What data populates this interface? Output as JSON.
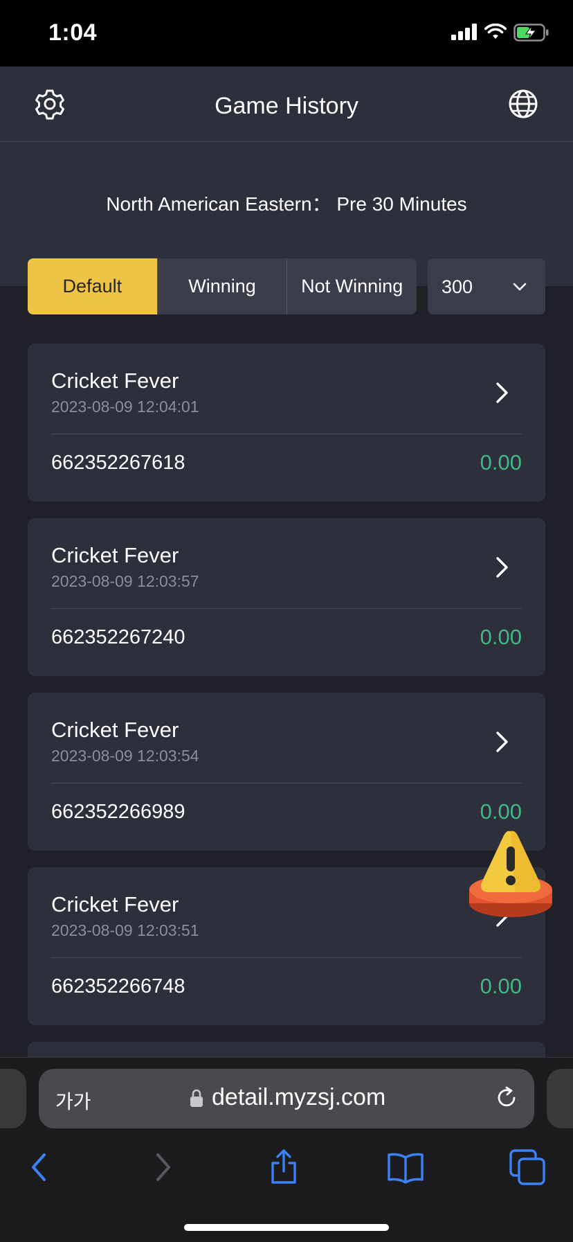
{
  "status_bar": {
    "time": "1:04"
  },
  "header": {
    "title": "Game History",
    "left_icon": "gear-icon",
    "right_icon": "globe-icon"
  },
  "timezone": "North American Eastern： Pre 30 Minutes",
  "filters": {
    "tabs": [
      {
        "label": "Default",
        "active": true
      },
      {
        "label": "Winning",
        "active": false
      },
      {
        "label": "Not Winning",
        "active": false
      }
    ],
    "count_select": {
      "value": "300"
    }
  },
  "records": [
    {
      "game": "Cricket Fever",
      "datetime": "2023-08-09 12:04:01",
      "id": "662352267618",
      "amount": "0.00"
    },
    {
      "game": "Cricket Fever",
      "datetime": "2023-08-09 12:03:57",
      "id": "662352267240",
      "amount": "0.00"
    },
    {
      "game": "Cricket Fever",
      "datetime": "2023-08-09 12:03:54",
      "id": "662352266989",
      "amount": "0.00"
    },
    {
      "game": "Cricket Fever",
      "datetime": "2023-08-09 12:03:51",
      "id": "662352266748",
      "amount": "0.00"
    }
  ],
  "browser": {
    "text_size": "가가",
    "url": "detail.myzsj.com"
  },
  "colors": {
    "accent": "#eec447",
    "amount": "#42b883",
    "card": "#2d2f3b",
    "background": "#1f2028",
    "link": "#3b82f6"
  }
}
